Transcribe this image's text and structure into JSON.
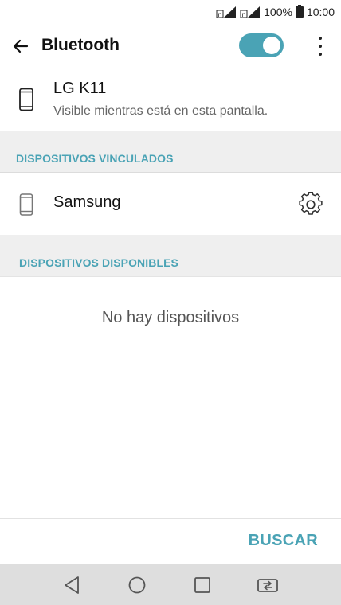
{
  "status_bar": {
    "battery_percent": "100%",
    "time": "10:00",
    "sim_label": "n",
    "icons": [
      "sim-signal-icon",
      "sim-signal-icon",
      "battery-icon"
    ]
  },
  "app_bar": {
    "back_icon": "back-arrow-icon",
    "title": "Bluetooth",
    "toggle_on": true,
    "overflow_icon": "overflow-menu-icon"
  },
  "this_device": {
    "icon": "phone-icon",
    "name": "LG K11",
    "visibility": "Visible mientras está en esta pantalla."
  },
  "paired": {
    "header": "DISPOSITIVOS VINCULADOS",
    "devices": [
      {
        "icon": "phone-icon",
        "name": "Samsung",
        "settings_icon": "gear-icon"
      }
    ]
  },
  "available": {
    "header": "DISPOSITIVOS DISPONIBLES",
    "empty_message": "No hay dispositivos"
  },
  "actions": {
    "scan_label": "BUSCAR"
  },
  "nav_bar": {
    "icons": [
      "back-triangle-icon",
      "home-circle-icon",
      "recents-square-icon",
      "dual-window-icon"
    ]
  },
  "colors": {
    "accent": "#4aa3b5",
    "section_bg": "#efefef",
    "nav_bg": "#dedede"
  }
}
